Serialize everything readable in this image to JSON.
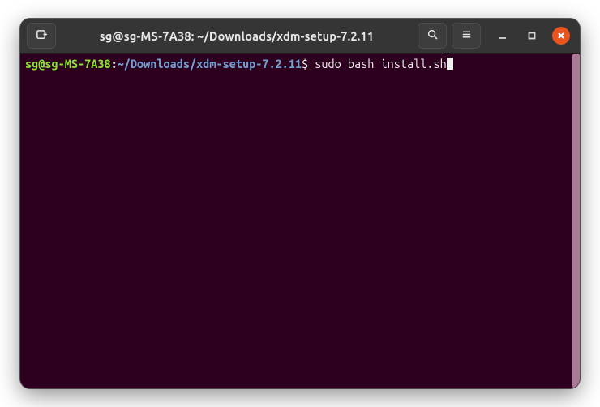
{
  "titlebar": {
    "title": "sg@sg-MS-7A38: ~/Downloads/xdm-setup-7.2.11",
    "new_tab_icon": "new-tab-icon",
    "search_icon": "search-icon",
    "menu_icon": "hamburger-menu-icon",
    "minimize_icon": "minimize-icon",
    "maximize_icon": "maximize-icon",
    "close_icon": "close-icon"
  },
  "terminal": {
    "prompt_user": "sg@sg-MS-7A38",
    "prompt_sep": ":",
    "prompt_path": "~/Downloads/xdm-setup-7.2.11",
    "prompt_symbol": "$",
    "command": "sudo bash install.sh"
  }
}
